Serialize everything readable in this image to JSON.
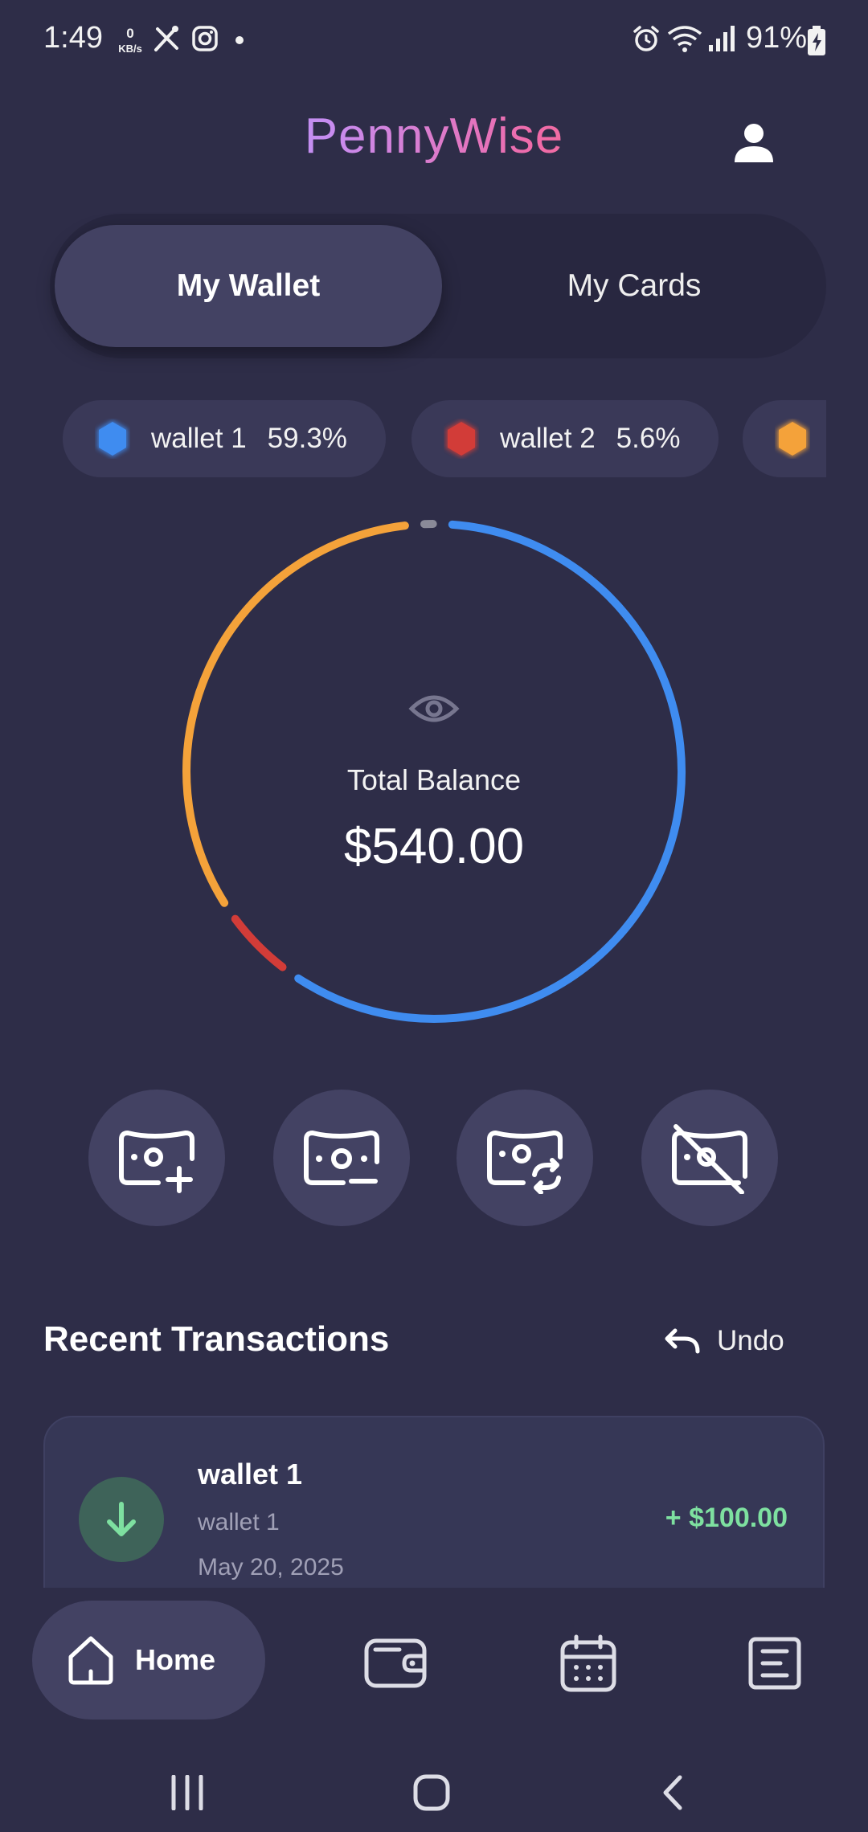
{
  "status_bar": {
    "time": "1:49",
    "net_speed_value": "0",
    "net_speed_unit": "KB/s",
    "battery": "91%"
  },
  "header": {
    "title": "PennyWise",
    "profile_icon": "person-icon"
  },
  "tabs": [
    {
      "label": "My Wallet",
      "selected": true
    },
    {
      "label": "My Cards",
      "selected": false
    }
  ],
  "wallets": [
    {
      "name": "wallet 1",
      "percent": "59.3%",
      "color": "#3f8cf0",
      "share": 59.3
    },
    {
      "name": "wallet 2",
      "percent": "5.6%",
      "color": "#d23c38",
      "share": 5.6
    },
    {
      "name": "",
      "percent": "",
      "color": "#f4a23a",
      "share": 33.3
    },
    {
      "name": "",
      "percent": "",
      "color": "#8a8a98",
      "share": 1.8
    }
  ],
  "balance": {
    "label": "Total Balance",
    "value": "$540.00"
  },
  "actions": [
    {
      "name": "add-money-button",
      "icon": "money-plus-icon"
    },
    {
      "name": "remove-money-button",
      "icon": "money-minus-icon"
    },
    {
      "name": "transfer-money-button",
      "icon": "money-transfer-icon"
    },
    {
      "name": "hide-money-button",
      "icon": "money-off-icon"
    }
  ],
  "recent": {
    "title": "Recent Transactions",
    "undo_label": "Undo",
    "transactions": [
      {
        "title": "wallet 1",
        "subtitle": "wallet 1",
        "date": "May 20, 2025",
        "amount": "+ $100.00",
        "type": "income"
      }
    ]
  },
  "bottom_nav": {
    "home_label": "Home",
    "items": [
      "home-icon",
      "wallet-icon",
      "calendar-icon",
      "report-icon"
    ]
  },
  "colors": {
    "background": "#2e2d48",
    "surface": "#434263",
    "income": "#7ee0a0"
  }
}
